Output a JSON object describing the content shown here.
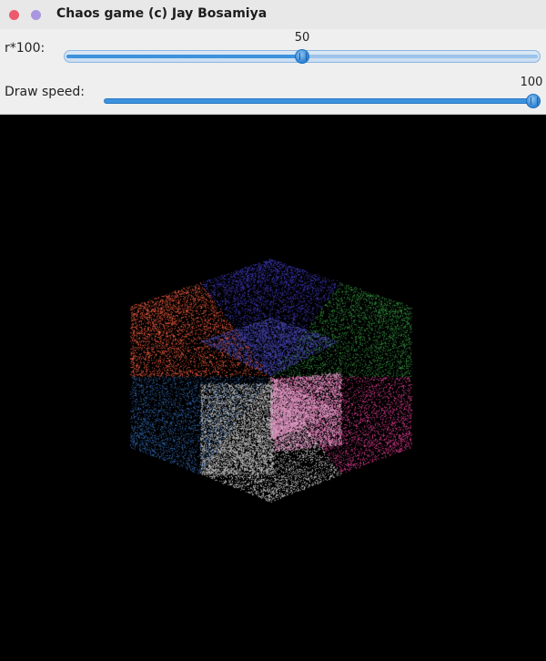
{
  "window": {
    "title": "Chaos game (c) Jay Bosamiya"
  },
  "controls": {
    "r_slider": {
      "label": "r*100:",
      "value": "50",
      "fraction": 0.5
    },
    "speed_slider": {
      "label": "Draw speed:",
      "value": "100",
      "fraction": 1.0
    }
  },
  "canvas": {
    "background": "#000000",
    "face_colors": {
      "top_left": "#e0553a",
      "top": "#3a36b0",
      "top_right": "#2f8a3a",
      "right": "#d23a8a",
      "bottom_right": "#e79ac8",
      "bottom": "#c8c8c8",
      "bottom_left": "#2e5fa0",
      "center_mix": "#4a4ab8"
    }
  }
}
